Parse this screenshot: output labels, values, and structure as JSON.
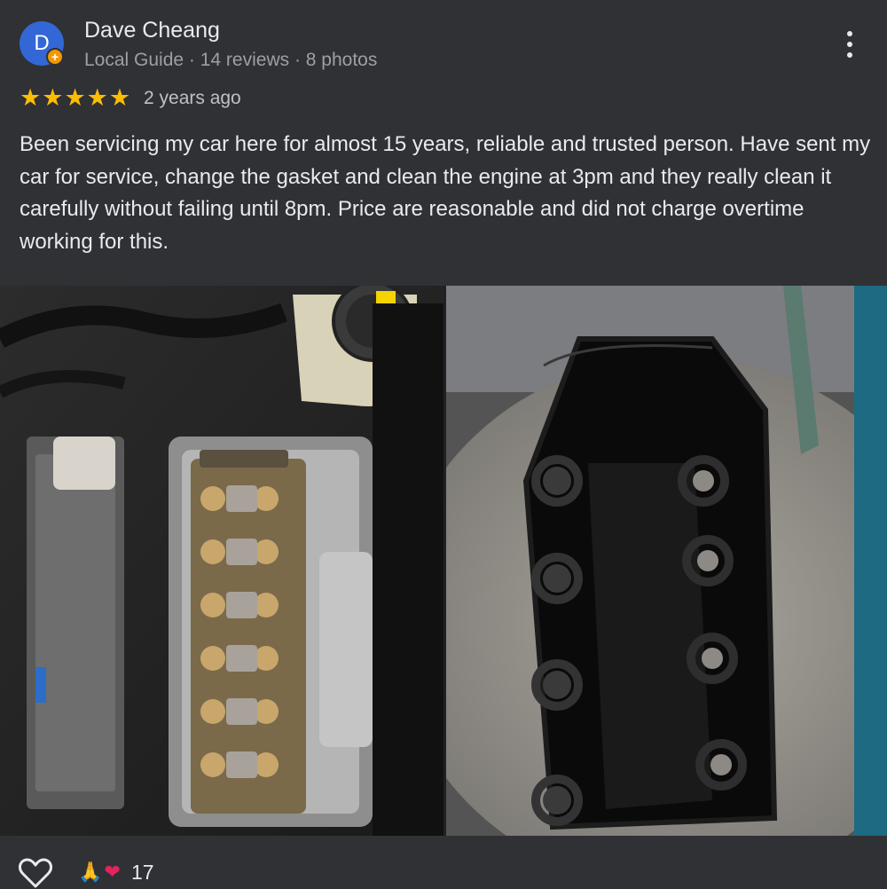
{
  "reviewer": {
    "initial": "D",
    "name": "Dave Cheang",
    "meta": "Local Guide · 14 reviews · 8 photos"
  },
  "rating": {
    "stars": 5,
    "max": 5
  },
  "time_ago": "2 years ago",
  "review_text": "Been servicing my car here for almost 15 years, reliable and trusted person. Have sent my car for service, change the gasket and clean the engine at 3pm and they really clean it carefully without failing until 8pm. Price are reasonable and did not charge overtime working for this.",
  "photos": [
    {
      "subject": "engine bay with valve cover removed"
    },
    {
      "subject": "cleaned valve cover gasket"
    }
  ],
  "reactions": {
    "icons": [
      "folded-hands-emoji",
      "red-heart-emoji"
    ],
    "count": "17"
  },
  "colors": {
    "background": "#303134",
    "star": "#fbbc04",
    "avatar": "#3367d6",
    "guide_badge": "#f29900"
  }
}
